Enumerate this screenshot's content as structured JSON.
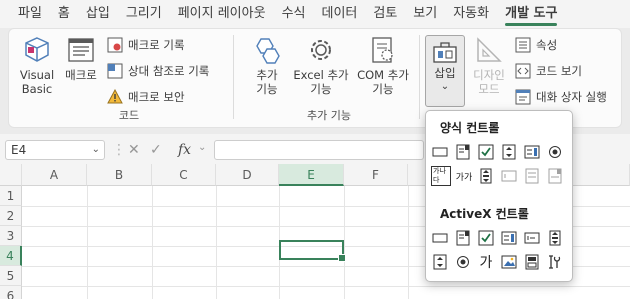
{
  "menu": {
    "items": [
      "파일",
      "홈",
      "삽입",
      "그리기",
      "페이지 레이아웃",
      "수식",
      "데이터",
      "검토",
      "보기",
      "자동화",
      "개발 도구"
    ],
    "active_index": 10
  },
  "ribbon": {
    "code_group": {
      "label": "코드",
      "visual_basic": "Visual Basic",
      "macro": "매크로",
      "record_macro": "매크로 기록",
      "relative_ref": "상대 참조로 기록",
      "macro_security": "매크로 보안"
    },
    "addins_group": {
      "label": "추가 기능",
      "addins": "추가 기능",
      "excel_addins": "Excel 추가 기능",
      "com_addins": "COM 추가 기능"
    },
    "controls_group": {
      "insert": "삽입",
      "design_mode": "디자인 모드",
      "properties": "속성",
      "view_code": "코드 보기",
      "run_dialog": "대화 상자 실행"
    }
  },
  "formula_bar": {
    "name_box": "E4",
    "cancel_symbol": "✕",
    "enter_symbol": "✓",
    "fx": "fx",
    "formula": ""
  },
  "grid": {
    "columns": [
      "A",
      "B",
      "C",
      "D",
      "E",
      "F"
    ],
    "rows": [
      "1",
      "2",
      "3",
      "4",
      "5",
      "6"
    ],
    "selected_column": "E",
    "selected_row": "4"
  },
  "dropdown": {
    "form_controls_title": "양식 컨트롤",
    "activex_title": "ActiveX 컨트롤",
    "form_label_control": "가가",
    "form_groupbox_label": "가나다",
    "activex_label_control": "가"
  },
  "colors": {
    "accent": "#1e7145",
    "selection_header": "#d3e7da"
  }
}
